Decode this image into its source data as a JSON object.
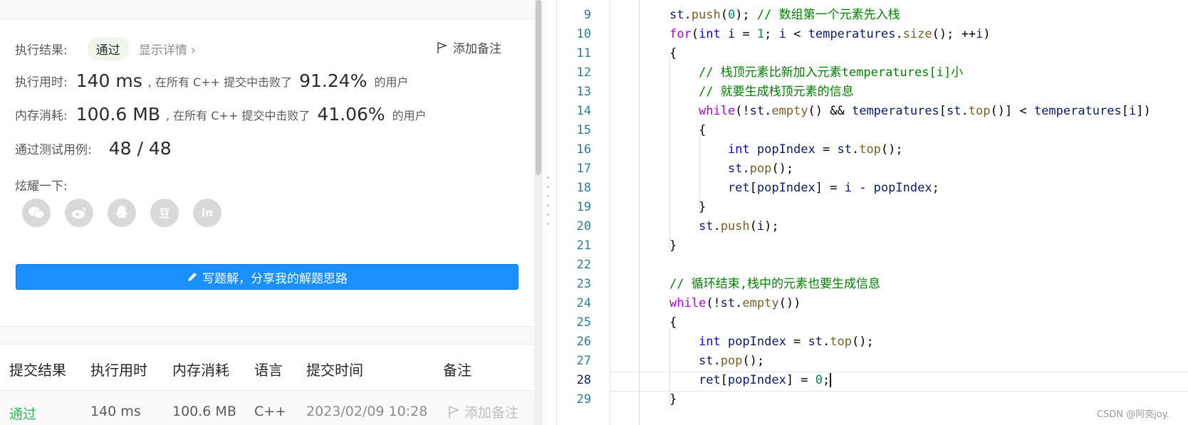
{
  "result": {
    "exec_result_label": "执行结果:",
    "status_badge": "通过",
    "show_details": "显示详情 ›",
    "add_note": "添加备注",
    "time_label": "执行用时:",
    "time_value": "140 ms",
    "beat_prefix": ", 在所有 C++ 提交中击败了",
    "time_beat": "91.24%",
    "users_suffix": "的用户",
    "memory_label": "内存消耗:",
    "memory_value": "100.6 MB",
    "memory_beat": "41.06%",
    "tests_label": "通过测试用例:",
    "tests_value": "48 / 48",
    "share_label": "炫耀一下:",
    "share_icons": [
      "wechat-icon",
      "weibo-icon",
      "qq-icon",
      "douban-icon",
      "linkedin-icon"
    ],
    "share_glyphs": [
      "",
      "",
      "",
      "豆",
      "in"
    ],
    "write_button": "写题解，分享我的解题思路"
  },
  "table": {
    "headers": [
      "提交结果",
      "执行用时",
      "内存消耗",
      "语言",
      "提交时间",
      "备注"
    ],
    "row": {
      "status": "通过",
      "time": "140 ms",
      "memory": "100.6 MB",
      "language": "C++",
      "submitted": "2023/02/09 10:28",
      "note": "添加备注"
    }
  },
  "code_lines": [
    {
      "n": "9",
      "tokens": [
        [
          "v",
          "st"
        ],
        [
          "pl",
          "."
        ],
        [
          "fn",
          "push"
        ],
        [
          "pl",
          "("
        ],
        [
          "num",
          "0"
        ],
        [
          "pl",
          "); "
        ],
        [
          "cm",
          "// 数组第一个元素先入栈"
        ]
      ]
    },
    {
      "n": "10",
      "tokens": [
        [
          "ctl",
          "for"
        ],
        [
          "pl",
          "("
        ],
        [
          "kw",
          "int"
        ],
        [
          "pl",
          " "
        ],
        [
          "v",
          "i"
        ],
        [
          "pl",
          " = "
        ],
        [
          "num",
          "1"
        ],
        [
          "pl",
          "; "
        ],
        [
          "v",
          "i"
        ],
        [
          "pl",
          " < "
        ],
        [
          "v",
          "temperatures"
        ],
        [
          "pl",
          "."
        ],
        [
          "fn",
          "size"
        ],
        [
          "pl",
          "(); ++"
        ],
        [
          "v",
          "i"
        ],
        [
          "pl",
          ")"
        ]
      ]
    },
    {
      "n": "11",
      "tokens": [
        [
          "pl",
          "{"
        ]
      ]
    },
    {
      "n": "12",
      "tokens": [
        [
          "pl",
          "    "
        ],
        [
          "cm",
          "// 栈顶元素比新加入元素temperatures[i]小"
        ]
      ]
    },
    {
      "n": "13",
      "tokens": [
        [
          "pl",
          "    "
        ],
        [
          "cm",
          "// 就要生成栈顶元素的信息"
        ]
      ]
    },
    {
      "n": "14",
      "tokens": [
        [
          "pl",
          "    "
        ],
        [
          "ctl",
          "while"
        ],
        [
          "pl",
          "(!"
        ],
        [
          "v",
          "st"
        ],
        [
          "pl",
          "."
        ],
        [
          "fn",
          "empty"
        ],
        [
          "pl",
          "() && "
        ],
        [
          "v",
          "temperatures"
        ],
        [
          "pl",
          "["
        ],
        [
          "v",
          "st"
        ],
        [
          "pl",
          "."
        ],
        [
          "fn",
          "top"
        ],
        [
          "pl",
          "()] < "
        ],
        [
          "v",
          "temperatures"
        ],
        [
          "pl",
          "["
        ],
        [
          "v",
          "i"
        ],
        [
          "pl",
          "])"
        ]
      ]
    },
    {
      "n": "15",
      "tokens": [
        [
          "pl",
          "    {"
        ]
      ]
    },
    {
      "n": "16",
      "tokens": [
        [
          "pl",
          "        "
        ],
        [
          "kw",
          "int"
        ],
        [
          "pl",
          " "
        ],
        [
          "v",
          "popIndex"
        ],
        [
          "pl",
          " = "
        ],
        [
          "v",
          "st"
        ],
        [
          "pl",
          "."
        ],
        [
          "fn",
          "top"
        ],
        [
          "pl",
          "();"
        ]
      ]
    },
    {
      "n": "17",
      "tokens": [
        [
          "pl",
          "        "
        ],
        [
          "v",
          "st"
        ],
        [
          "pl",
          "."
        ],
        [
          "fn",
          "pop"
        ],
        [
          "pl",
          "();"
        ]
      ]
    },
    {
      "n": "18",
      "tokens": [
        [
          "pl",
          "        "
        ],
        [
          "v",
          "ret"
        ],
        [
          "pl",
          "["
        ],
        [
          "v",
          "popIndex"
        ],
        [
          "pl",
          "] = "
        ],
        [
          "v",
          "i"
        ],
        [
          "pl",
          " - "
        ],
        [
          "v",
          "popIndex"
        ],
        [
          "pl",
          ";"
        ]
      ]
    },
    {
      "n": "19",
      "tokens": [
        [
          "pl",
          "    }"
        ]
      ]
    },
    {
      "n": "20",
      "tokens": [
        [
          "pl",
          "    "
        ],
        [
          "v",
          "st"
        ],
        [
          "pl",
          "."
        ],
        [
          "fn",
          "push"
        ],
        [
          "pl",
          "("
        ],
        [
          "v",
          "i"
        ],
        [
          "pl",
          ");"
        ]
      ]
    },
    {
      "n": "21",
      "tokens": [
        [
          "pl",
          "}"
        ]
      ]
    },
    {
      "n": "22",
      "tokens": []
    },
    {
      "n": "23",
      "tokens": [
        [
          "cm",
          "// 循环结束,栈中的元素也要生成信息"
        ]
      ]
    },
    {
      "n": "24",
      "tokens": [
        [
          "ctl",
          "while"
        ],
        [
          "pl",
          "(!"
        ],
        [
          "v",
          "st"
        ],
        [
          "pl",
          "."
        ],
        [
          "fn",
          "empty"
        ],
        [
          "pl",
          "())"
        ]
      ]
    },
    {
      "n": "25",
      "tokens": [
        [
          "pl",
          "{"
        ]
      ]
    },
    {
      "n": "26",
      "tokens": [
        [
          "pl",
          "    "
        ],
        [
          "kw",
          "int"
        ],
        [
          "pl",
          " "
        ],
        [
          "v",
          "popIndex"
        ],
        [
          "pl",
          " = "
        ],
        [
          "v",
          "st"
        ],
        [
          "pl",
          "."
        ],
        [
          "fn",
          "top"
        ],
        [
          "pl",
          "();"
        ]
      ]
    },
    {
      "n": "27",
      "tokens": [
        [
          "pl",
          "    "
        ],
        [
          "v",
          "st"
        ],
        [
          "pl",
          "."
        ],
        [
          "fn",
          "pop"
        ],
        [
          "pl",
          "();"
        ]
      ]
    },
    {
      "n": "28",
      "tokens": [
        [
          "pl",
          "    "
        ],
        [
          "v",
          "ret"
        ],
        [
          "pl",
          "["
        ],
        [
          "v",
          "popIndex"
        ],
        [
          "pl",
          "] = "
        ],
        [
          "num",
          "0"
        ],
        [
          "pl",
          ";"
        ]
      ],
      "caret": true
    },
    {
      "n": "29",
      "tokens": [
        [
          "pl",
          "}"
        ]
      ]
    }
  ],
  "watermark": "CSDN @阿亮joy."
}
